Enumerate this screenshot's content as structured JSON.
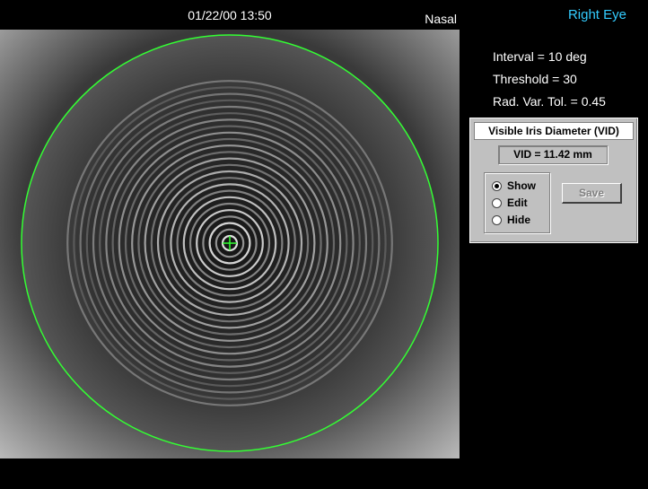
{
  "header": {
    "timestamp": "01/22/00 13:50",
    "orientation": "Nasal",
    "eye": "Right Eye"
  },
  "stats": {
    "interval": "Interval = 10 deg",
    "threshold": "Threshold = 30",
    "rad_var_tol": "Rad. Var. Tol. = 0.45"
  },
  "vid_panel": {
    "title": "Visible Iris Diameter (VID)",
    "value": "VID = 11.42 mm",
    "options": [
      {
        "label": "Show",
        "checked": true
      },
      {
        "label": "Edit",
        "checked": false
      },
      {
        "label": "Hide",
        "checked": false
      }
    ],
    "save_label": "Save"
  },
  "colors": {
    "iris_circle": "#33ff33",
    "eye_side_text": "#33ccff",
    "center_marker": "#33ff33"
  }
}
